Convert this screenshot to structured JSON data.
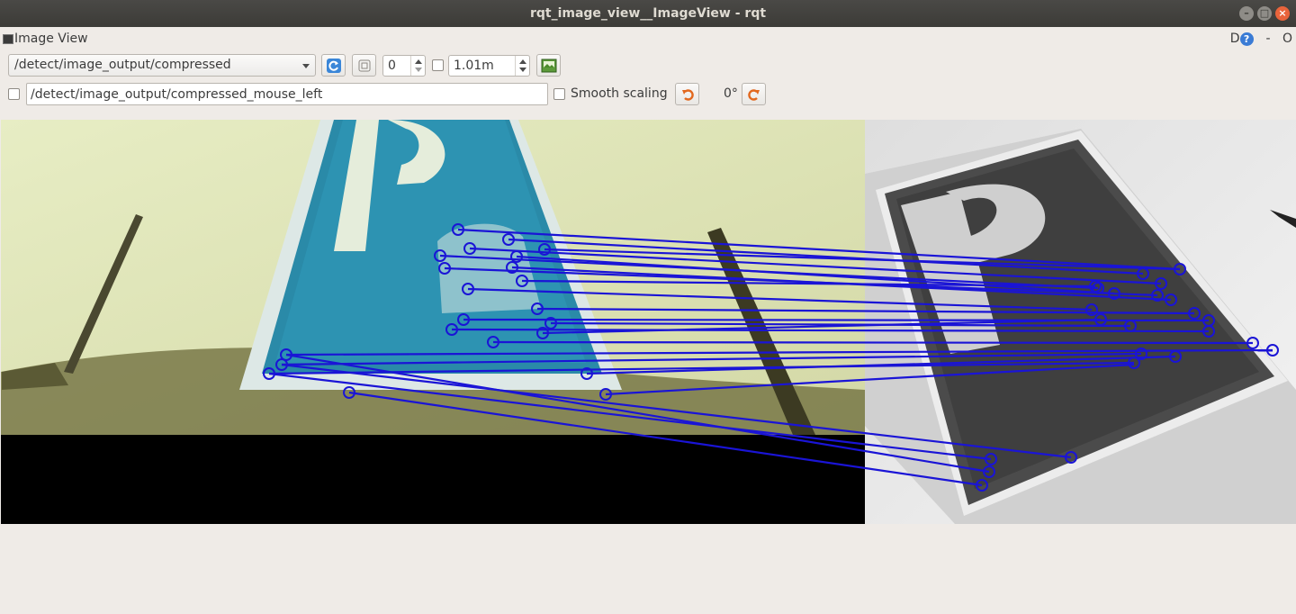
{
  "window": {
    "title": "rqt_image_view__ImageView - rqt",
    "minimize_glyph": "–",
    "maximize_glyph": "□",
    "close_glyph": "×"
  },
  "dock": {
    "title": "Image View",
    "ctrl_d": "D",
    "help_glyph": "?",
    "ctrl_minus": "-",
    "ctrl_o": "O"
  },
  "toolbar": {
    "topic_selected": "/detect/image_output/compressed",
    "refresh_icon": "refresh-icon",
    "zoom_value": "0",
    "max_range_value": "1.01m",
    "save_icon": "save-icon"
  },
  "row2": {
    "mouse_topic": "/detect/image_output/compressed_mouse_left",
    "smooth_scaling_label": "Smooth scaling",
    "rotation": "0°",
    "rotate_left_icon": "rotate-ccw-icon",
    "rotate_right_icon": "rotate-cw-icon"
  },
  "colors": {
    "match_line": "#1a14d6",
    "sign_blue": "#2a8aa8",
    "background_yellow": "#e6ecbf"
  }
}
